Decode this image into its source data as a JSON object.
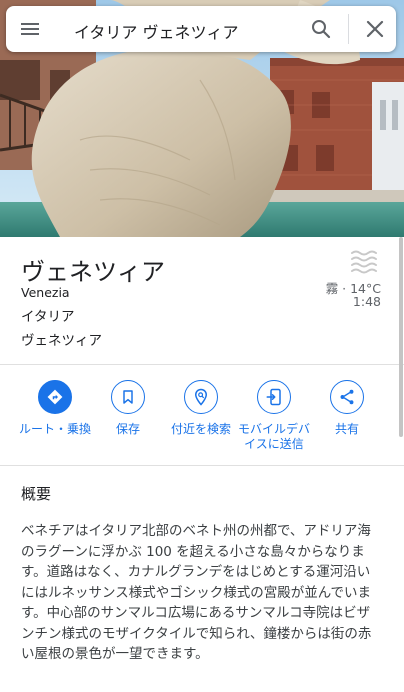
{
  "search": {
    "query": "イタリア ヴェネツィア"
  },
  "place": {
    "title": "ヴェネツィア",
    "subtitle": "Venezia",
    "country": "イタリア",
    "region": "ヴェネツィア"
  },
  "weather": {
    "icon": "fog-icon",
    "condition_temp": "霧 · 14°C",
    "time": "1:48"
  },
  "actions": [
    {
      "label": "ルート・乗換",
      "icon": "directions-icon"
    },
    {
      "label": "保存",
      "icon": "bookmark-icon"
    },
    {
      "label": "付近を検索",
      "icon": "nearby-icon"
    },
    {
      "label": "モバイルデバイスに送信",
      "icon": "send-to-phone-icon"
    },
    {
      "label": "共有",
      "icon": "share-icon"
    }
  ],
  "overview": {
    "title": "概要",
    "body": "ベネチアはイタリア北部のベネト州の州都で、アドリア海のラグーンに浮かぶ 100 を超える小さな島々からなります。道路はなく、カナルグランデをはじめとする運河沿いにはルネッサンス様式やゴシック様式の宮殿が並んでいます。中心部のサンマルコ広場にあるサンマルコ寺院はビザンチン様式のモザイクタイルで知られ、鐘楼からは街の赤い屋根の景色が一望できます。"
  },
  "colors": {
    "accent": "#1a73e8",
    "text_primary": "#202124",
    "text_secondary": "#5f6368"
  }
}
